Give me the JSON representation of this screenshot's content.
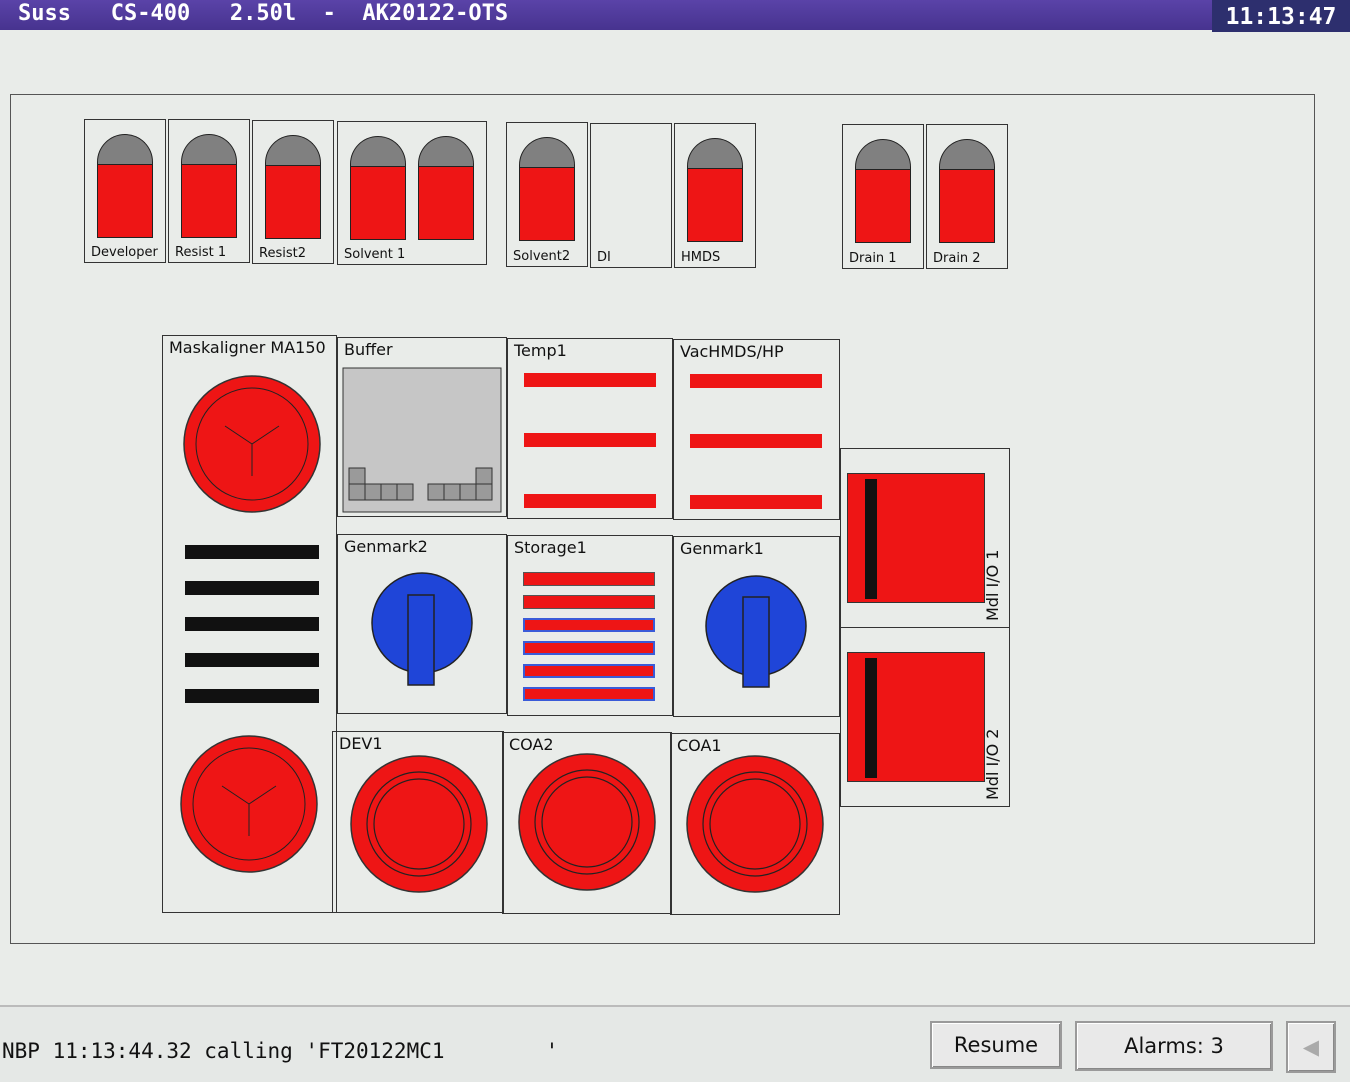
{
  "window": {
    "title": "Suss   CS-400   2.50l  -  AK20122-OTS",
    "clock": "11:13:47"
  },
  "tanks": [
    {
      "label": "Developer"
    },
    {
      "label": "Resist 1"
    },
    {
      "label": "Resist2"
    },
    {
      "label": "Solvent 1"
    },
    {
      "label": "Solvent2"
    },
    {
      "label": "DI"
    },
    {
      "label": "HMDS"
    },
    {
      "label": "Drain 1"
    },
    {
      "label": "Drain 2"
    }
  ],
  "modules": {
    "maskaligner": "Maskaligner MA150",
    "buffer": "Buffer",
    "temp1": "Temp1",
    "vachmds": "VacHMDS/HP",
    "genmark2": "Genmark2",
    "storage1": "Storage1",
    "genmark1": "Genmark1",
    "dev1": "DEV1",
    "coa2": "COA2",
    "coa1": "COA1",
    "mdl1": "Mdl I/O 1",
    "mdl2": "Mdl I/O 2"
  },
  "status": {
    "message": "NBP 11:13:44.32 calling 'FT20122MC1        '",
    "resume_label": "Resume",
    "alarms_label": "Alarms:  3"
  },
  "colors": {
    "active": "#ee1515",
    "robot": "#1f45d8",
    "title": "#4a3596"
  }
}
